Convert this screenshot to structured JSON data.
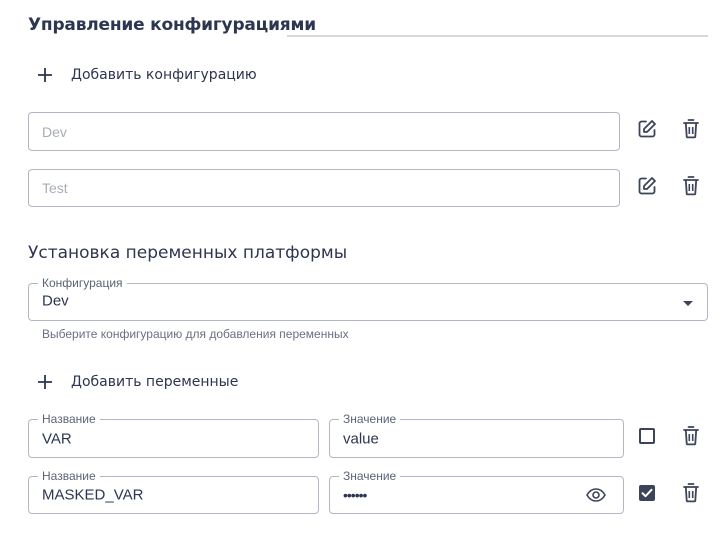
{
  "config": {
    "title": "Управление конфигурациями",
    "add_label": "Добавить конфигурацию",
    "items": [
      {
        "placeholder": "Dev"
      },
      {
        "placeholder": "Test"
      }
    ]
  },
  "variables": {
    "title": "Установка переменных платформы",
    "select": {
      "label": "Конфигурация",
      "value": "Dev",
      "helper": "Выберите конфигурацию для добавления переменных"
    },
    "add_label": "Добавить переменные",
    "rows": [
      {
        "name_label": "Название",
        "name_value": "VAR",
        "value_label": "Значение",
        "value_value": "value",
        "masked": false
      },
      {
        "name_label": "Название",
        "name_value": "MASKED_VAR",
        "value_label": "Значение",
        "value_value": "••••••",
        "masked": true
      }
    ]
  },
  "icons": {
    "add": "plus-icon",
    "edit": "edit-icon",
    "delete": "trash-icon",
    "toggle_visibility": "eye-icon",
    "dropdown": "caret-down-icon"
  },
  "colors": {
    "text": "#2c3650",
    "border": "#b3b7c3",
    "placeholder": "#a9adb8",
    "icon": "#3b4458",
    "rule": "#d6d8e0"
  }
}
